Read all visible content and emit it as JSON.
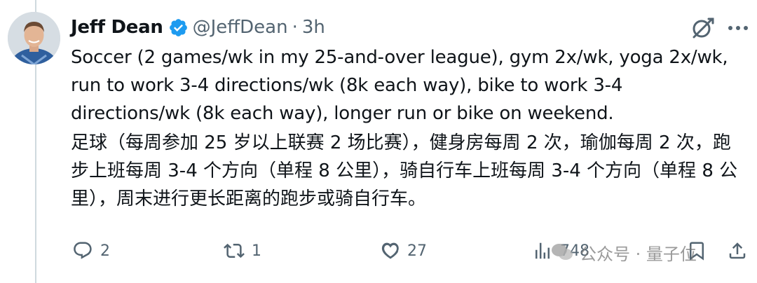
{
  "author": {
    "name": "Jeff Dean",
    "handle": "@JeffDean",
    "separator": "·",
    "time": "3h"
  },
  "tweet": {
    "text_en": "Soccer (2 games/wk in my 25-and-over league), gym 2x/wk, yoga 2x/wk, run to work 3-4 directions/wk (8k each way), bike to work 3-4 directions/wk (8k each way), longer run or bike on weekend.",
    "text_zh": "足球（每周参加 25 岁以上联赛 2 场比赛），健身房每周 2 次，瑜伽每周 2 次，跑步上班每周 3-4 个方向（单程 8 公里），骑自行车上班每周 3-4 个方向（单程 8 公里），周末进行更长距离的跑步或骑自行车。"
  },
  "actions": {
    "replies": "2",
    "reposts": "1",
    "likes": "27",
    "views": "748"
  },
  "watermark": {
    "text": "公众号 · 量子位"
  },
  "colors": {
    "text_primary": "#0f1419",
    "text_secondary": "#536471",
    "verified_blue": "#1d9bf0",
    "thread_line": "#cfd9de"
  },
  "icons": {
    "verified": "verified-badge-icon",
    "grok": "grok-icon",
    "more": "more-icon",
    "reply": "reply-icon",
    "repost": "repost-icon",
    "like": "like-icon",
    "views": "views-icon",
    "bookmark": "bookmark-icon",
    "share": "share-icon"
  }
}
